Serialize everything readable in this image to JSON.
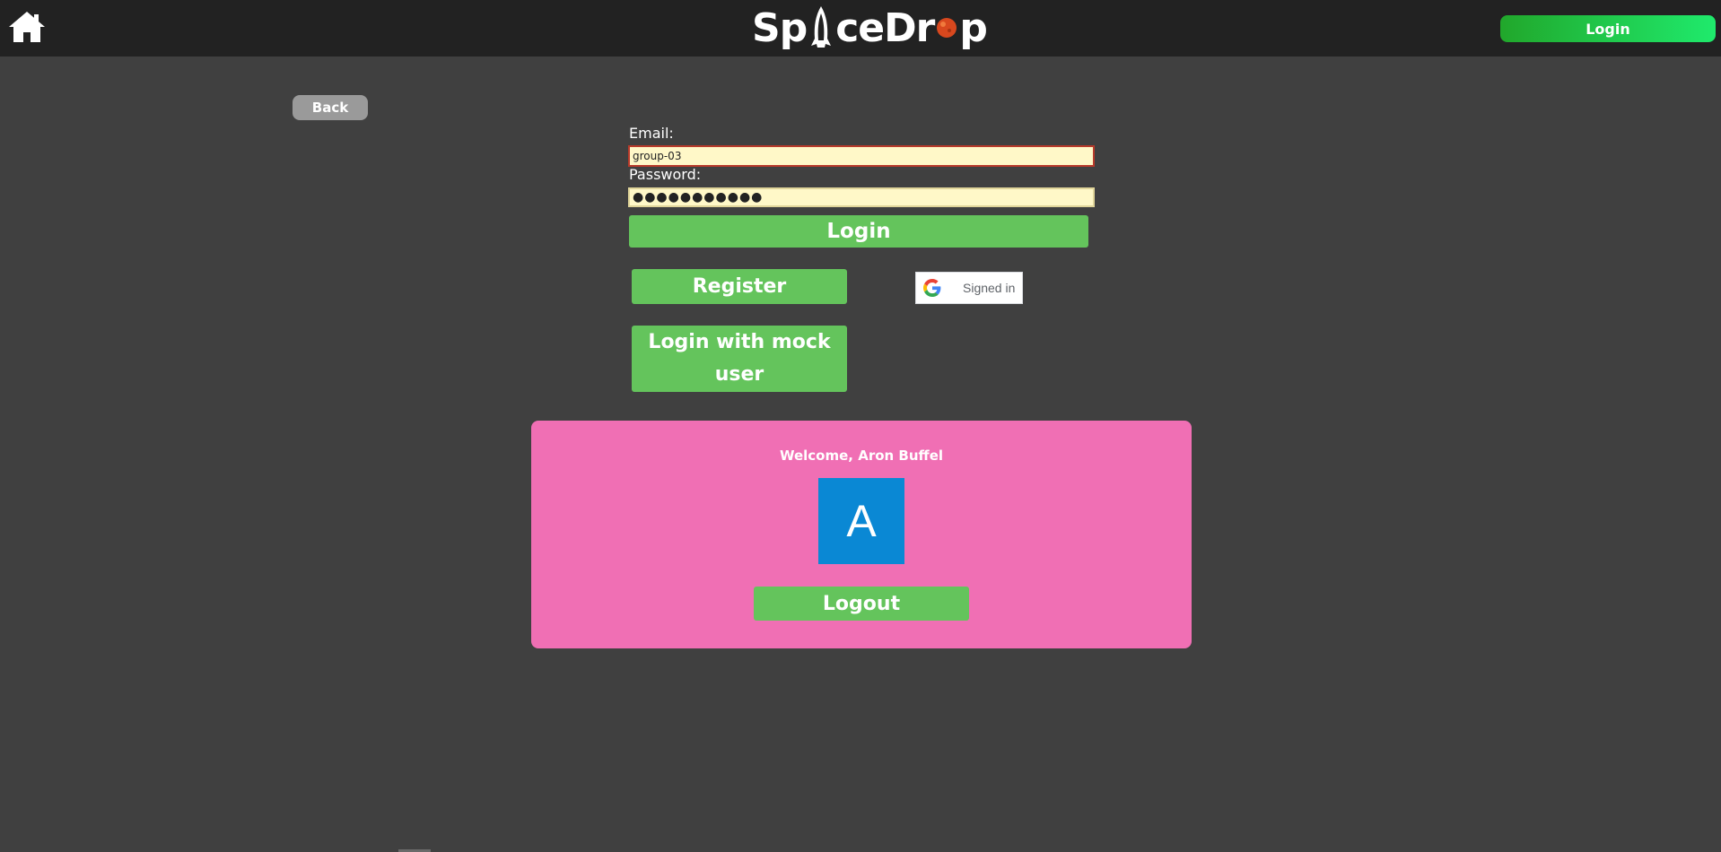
{
  "header": {
    "logo_text_left": "Sp",
    "logo_text_mid": "ceDr",
    "logo_text_right": "p",
    "login_button": "Login"
  },
  "back_button": "Back",
  "form": {
    "email_label": "Email:",
    "email_value": "group-03",
    "password_label": "Password:",
    "password_value": "●●●●●●●●●●●",
    "login_button": "Login",
    "register_button": "Register",
    "mock_login_button": "Login with mock user",
    "google_button": "Signed in"
  },
  "welcome": {
    "text": "Welcome, Aron Buffel",
    "avatar_letter": "A",
    "logout_button": "Logout"
  },
  "colors": {
    "background": "#404040",
    "topbar": "#222222",
    "green_button": "#64c45c",
    "card": "#f06fb4",
    "avatar": "#0a88d4"
  },
  "icons": [
    "home-icon",
    "rocket-icon",
    "planet-icon",
    "google-icon"
  ]
}
